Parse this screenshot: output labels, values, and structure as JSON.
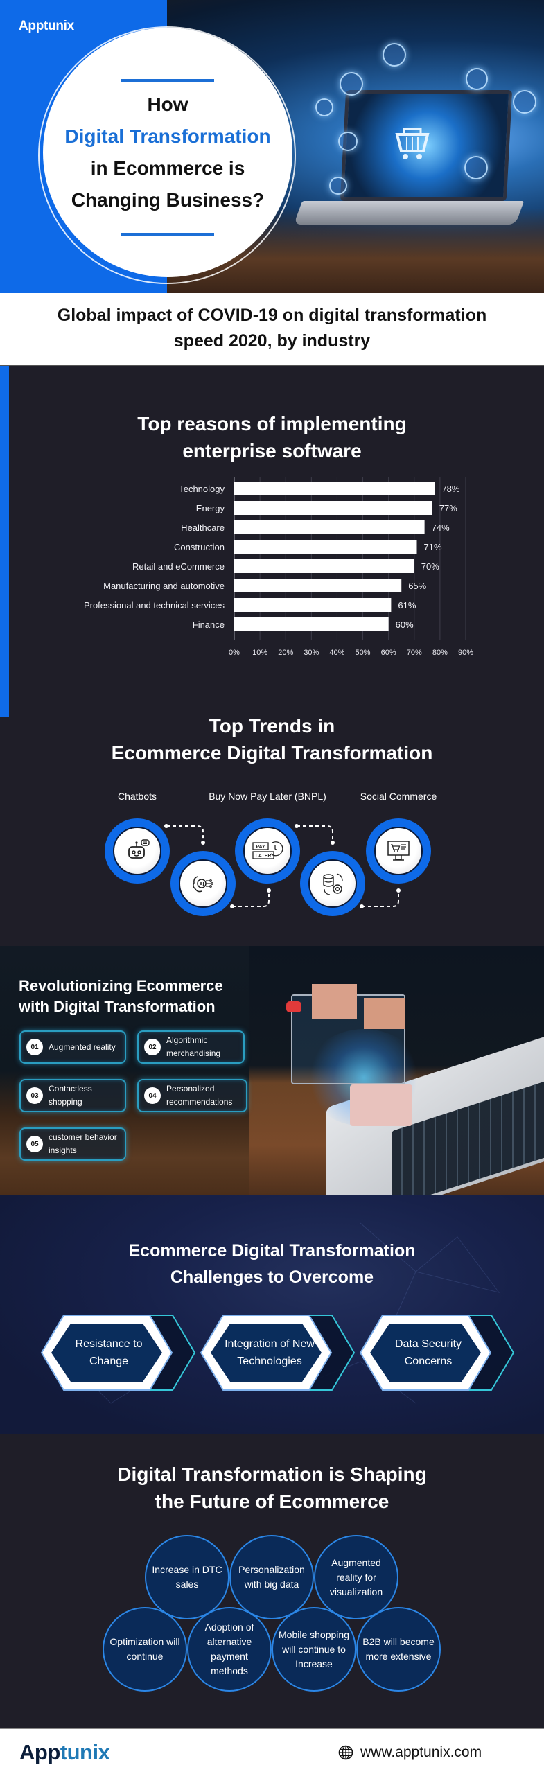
{
  "brand": {
    "name": "Apptunix",
    "name_part1": "App",
    "name_part2": "tunix",
    "colors": {
      "primary_blue": "#0e6ae8",
      "dark_bg": "#1f1e28",
      "navy": "#0a2a58",
      "teal_glow": "#2a9dc0"
    }
  },
  "hero": {
    "title_line1": "How",
    "title_line2": "Digital Transformation",
    "title_line3": "in Ecommerce is",
    "title_line4": "Changing Business?",
    "image_icons": [
      "shopping-cart-icon",
      "lock-icon",
      "calendar-icon",
      "credit-card-icon",
      "laptop-icon",
      "fingerprint-icon",
      "store-icon",
      "bag-icon",
      "server-icon"
    ]
  },
  "covid_banner": {
    "line1": "Global impact of COVID-19 on digital transformation",
    "line2": "speed 2020, by industry"
  },
  "chart_data": {
    "type": "bar",
    "orientation": "horizontal",
    "title": "Top reasons of implementing enterprise software",
    "title_line1": "Top reasons of implementing",
    "title_line2": "enterprise software",
    "categories": [
      "Technology",
      "Energy",
      "Healthcare",
      "Construction",
      "Retail and eCommerce",
      "Manufacturing and automotive",
      "Professional and technical services",
      "Finance"
    ],
    "values": [
      78,
      77,
      74,
      71,
      70,
      65,
      61,
      60
    ],
    "value_labels": [
      "78%",
      "77%",
      "74%",
      "71%",
      "70%",
      "65%",
      "61%",
      "60%"
    ],
    "xticks": [
      "0%",
      "10%",
      "20%",
      "30%",
      "40%",
      "50%",
      "60%",
      "70%",
      "80%",
      "90%"
    ],
    "xlim": [
      0,
      90
    ],
    "xlabel": "",
    "ylabel": "",
    "grid": true,
    "legend": "none"
  },
  "trends": {
    "title_line1": "Top Trends in",
    "title_line2": "Ecommerce Digital Transformation",
    "labels": [
      "Chatbots",
      "Buy Now Pay Later (BNPL)",
      "Social Commerce"
    ],
    "items": [
      {
        "icon": "chatbot-icon"
      },
      {
        "icon": "ai-brain-icon",
        "icon_text": "AI"
      },
      {
        "icon": "pay-later-icon",
        "icon_text1": "PAY",
        "icon_text2": "LATER"
      },
      {
        "icon": "cloud-database-sync-icon"
      },
      {
        "icon": "online-store-monitor-icon"
      }
    ]
  },
  "revolutionizing": {
    "title_line1": "Revolutionizing Ecommerce",
    "title_line2": "with Digital Transformation",
    "items": [
      {
        "num": "01",
        "text": "Augmented reality"
      },
      {
        "num": "02",
        "text": "Algorithmic merchandising"
      },
      {
        "num": "03",
        "text": "Contactless shopping"
      },
      {
        "num": "04",
        "text": "Personalized recommendations"
      },
      {
        "num": "05",
        "text": "customer behavior insights"
      }
    ]
  },
  "challenges": {
    "title_line1": "Ecommerce Digital Transformation",
    "title_line2": "Challenges to Overcome",
    "items": [
      {
        "line1": "Resistance to",
        "line2": "Change"
      },
      {
        "line1": "Integration of New",
        "line2": "Technologies"
      },
      {
        "line1": "Data Security",
        "line2": "Concerns"
      }
    ]
  },
  "future": {
    "title_line1": "Digital Transformation is Shaping",
    "title_line2": "the Future of Ecommerce",
    "items": [
      "Increase in DTC sales",
      "Personalization with big data",
      "Augmented reality for visualization",
      "Optimization will continue",
      "Adoption of alternative payment methods",
      "Mobile shopping will continue to Increase",
      "B2B will become more extensive"
    ]
  },
  "footer": {
    "website": "www.apptunix.com",
    "globe_icon": "globe-icon"
  }
}
